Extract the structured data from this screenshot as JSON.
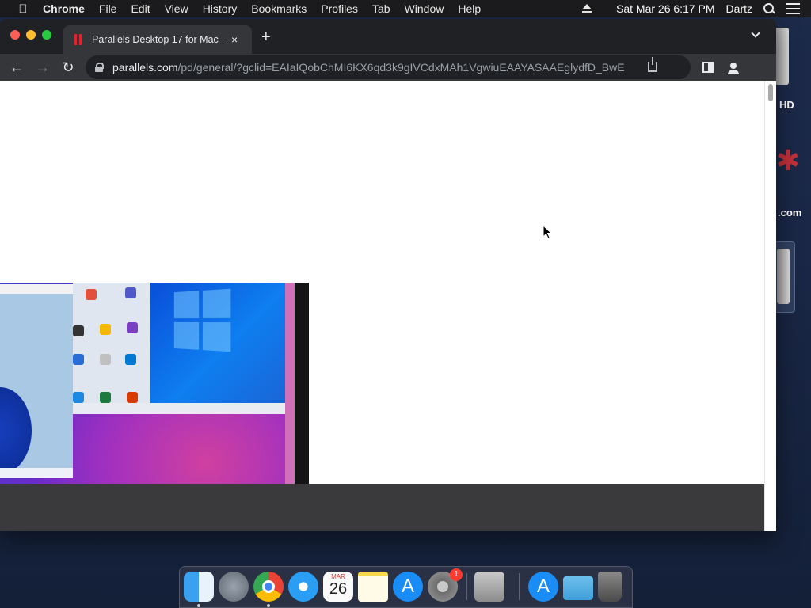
{
  "menubar": {
    "app_name": "Chrome",
    "items": [
      "File",
      "Edit",
      "View",
      "History",
      "Bookmarks",
      "Profiles",
      "Tab",
      "Window",
      "Help"
    ],
    "clock": "Sat Mar 26  6:17 PM",
    "user": "Dartz"
  },
  "desktop": {
    "hd_label": "HD",
    "com_label": ".com"
  },
  "browser": {
    "tab_title": "Parallels Desktop 17 for Mac -",
    "new_tab_symbol": "+",
    "tab_close_symbol": "×",
    "url_host": "parallels.com",
    "url_path": "/pd/general/?gclid=EAIaIQobChMI6KX6qd3k9gIVCdxMAh1VgwiuEAAYASAAEglydfD_BwE"
  },
  "dock": {
    "calendar_month": "MAR",
    "calendar_day": "26",
    "settings_badge": "1"
  },
  "colors": {
    "tab_favicon": "#e0242f",
    "desktop_bg": "#1d2a4a"
  }
}
